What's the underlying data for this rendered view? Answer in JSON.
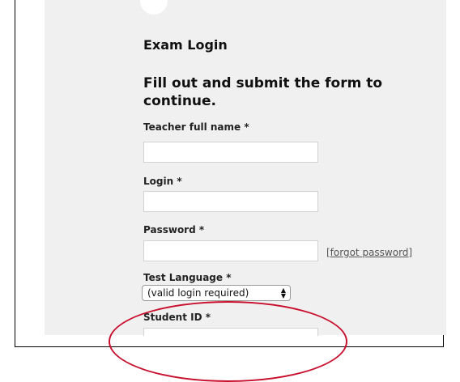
{
  "page": {
    "title": "Exam Login",
    "subtitle": "Fill out and submit the form to continue."
  },
  "fields": {
    "teacher_full_name": {
      "label": "Teacher full name *",
      "value": "",
      "placeholder": ""
    },
    "login": {
      "label": "Login *",
      "value": "",
      "placeholder": ""
    },
    "password": {
      "label": "Password *",
      "value": "",
      "placeholder": ""
    },
    "test_language": {
      "label": "Test Language *",
      "selected_option": "(valid login required)"
    },
    "student_id": {
      "label": "Student ID *",
      "value": "",
      "placeholder": ""
    }
  },
  "links": {
    "forgot_password": "[forgot password]"
  },
  "annotations": {
    "highlight_color": "#c8102e"
  },
  "icons": {
    "select_arrows": "up-down-chevron-icon"
  }
}
